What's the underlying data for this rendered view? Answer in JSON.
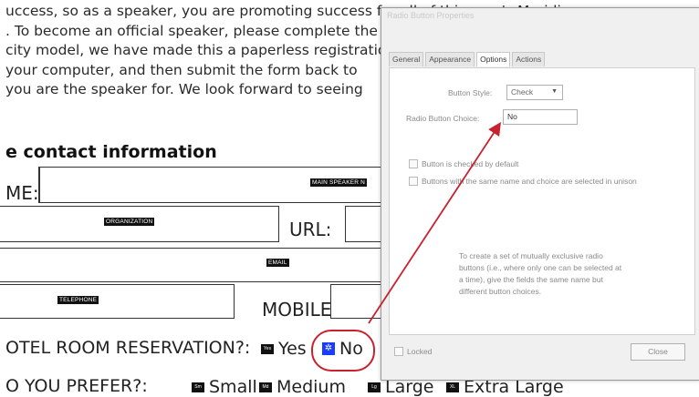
{
  "document": {
    "paragraph_lines": [
      "uccess, so as a speaker, you are promoting success for all of this year's Meridian",
      ". To become an official speaker, please complete the form",
      "city model, we have made this a paperless registration",
      "your computer, and then submit the form back to",
      "you are the speaker for. We look forward to seeing"
    ],
    "section_title": "e contact information",
    "labels": {
      "name": "ME:",
      "url": "URL:",
      "mobile": "MOBILE:",
      "hotel_question": "OTEL ROOM RESERVATION?:",
      "prefer_question": "O YOU PREFER?:"
    },
    "field_tags": {
      "name": "MAIN SPEAKER N",
      "organization": "ORGANIZATION",
      "email": "EMAIL",
      "telephone": "TELEPHONE"
    },
    "hotel_options": [
      {
        "code": "Yes",
        "label": "Yes"
      },
      {
        "code": "No",
        "label": "No"
      }
    ],
    "size_options": [
      {
        "code": "Sm",
        "label": "Small"
      },
      {
        "code": "Md",
        "label": "Medium"
      },
      {
        "code": "Lg",
        "label": "Large"
      },
      {
        "code": "XL",
        "label": "Extra Large"
      }
    ]
  },
  "dialog": {
    "title": "Radio Button Properties",
    "tabs": [
      "General",
      "Appearance",
      "Options",
      "Actions"
    ],
    "active_tab": "Options",
    "button_style_label": "Button Style:",
    "button_style_value": "Check",
    "radio_choice_label": "Radio Button Choice:",
    "radio_choice_value": "No",
    "checkbox_default": "Button is checked by default",
    "checkbox_unison": "Buttons with the same name and choice are selected in unison",
    "info_text": "To create a set of mutually exclusive radio buttons (i.e., where only one can be selected at a time), give the fields the same name but different button choices.",
    "locked_label": "Locked",
    "close_label": "Close"
  },
  "colors": {
    "annotation_red": "#c8222e",
    "selected_blue": "#1a3cff"
  }
}
